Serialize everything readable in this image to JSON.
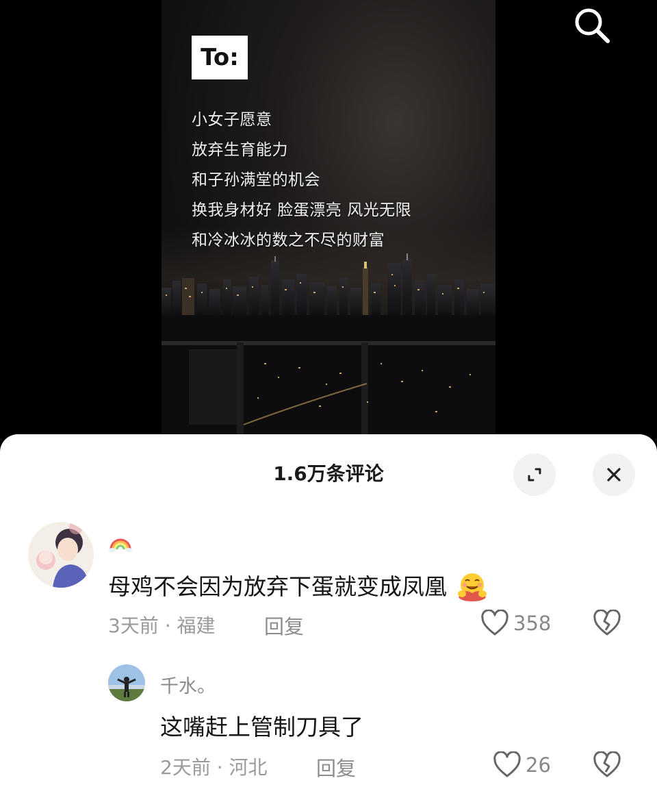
{
  "video": {
    "label": "To:",
    "caption_lines": [
      "小女子愿意",
      "放弃生育能力",
      "和子孙满堂的机会",
      "换我身材好 脸蛋漂亮 风光无限",
      "和冷冰冰的数之不尽的财富"
    ],
    "search_icon": "search-icon"
  },
  "comments_sheet": {
    "title": "1.6万条评论",
    "expand_icon": "expand-icon",
    "close_icon": "close-icon",
    "comments": [
      {
        "username_emoji": "rainbow-emoji",
        "text": "母鸡不会因为放弃下蛋就变成凤凰",
        "text_emoji": "hugging-face-emoji",
        "time": "3天前",
        "separator": "·",
        "location": "福建",
        "reply_label": "回复",
        "likes": "358",
        "like_icon": "heart-outline-icon",
        "dislike_icon": "broken-heart-icon"
      },
      {
        "username": "千水。",
        "text": "这嘴赶上管制刀具了",
        "time": "2天前",
        "separator": "·",
        "location": "河北",
        "reply_label": "回复",
        "likes": "26",
        "like_icon": "heart-outline-icon",
        "dislike_icon": "broken-heart-icon"
      }
    ]
  },
  "colors": {
    "background": "#000000",
    "sheet": "#ffffff",
    "secondary_text": "#8a8a8a",
    "primary_text": "#161616"
  }
}
